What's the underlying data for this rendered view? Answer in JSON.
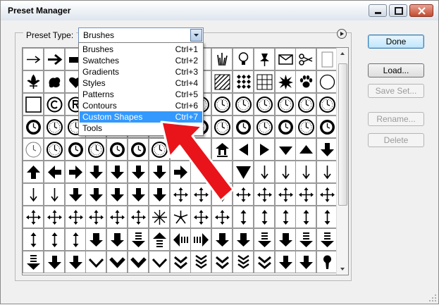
{
  "window": {
    "title": "Preset Manager",
    "controls": [
      "minimize-icon",
      "maximize-icon",
      "close-icon"
    ]
  },
  "preset_type": {
    "label": "Preset Type:",
    "selected": "Brushes",
    "options": [
      {
        "label": "Brushes",
        "shortcut": "Ctrl+1"
      },
      {
        "label": "Swatches",
        "shortcut": "Ctrl+2"
      },
      {
        "label": "Gradients",
        "shortcut": "Ctrl+3"
      },
      {
        "label": "Styles",
        "shortcut": "Ctrl+4"
      },
      {
        "label": "Patterns",
        "shortcut": "Ctrl+5"
      },
      {
        "label": "Contours",
        "shortcut": "Ctrl+6"
      },
      {
        "label": "Custom Shapes",
        "shortcut": "Ctrl+7"
      },
      {
        "label": "Tools",
        "shortcut": "Ctrl+8"
      }
    ],
    "highlighted": "Custom Shapes"
  },
  "buttons": {
    "done": "Done",
    "load": "Load...",
    "save_set": "Save Set...",
    "rename": "Rename...",
    "delete": "Delete"
  },
  "shapes_rows": [
    [
      "arrow-thin-right",
      "arrow-bold-right",
      "rect-bar",
      "",
      "",
      "",
      "",
      "",
      "",
      "grass",
      "lightbulb",
      "pushpin",
      "envelope",
      "scissors",
      "blank-frame"
    ],
    [
      "fleur-de-lis",
      "blob",
      "heart",
      "",
      "",
      "",
      "",
      "",
      "",
      "hatched-square",
      "diamond-grid",
      "grid-square",
      "burst",
      "paw-print",
      "circle-outline"
    ],
    [
      "square-outline",
      "copyright-circle",
      "registered-circle",
      "",
      "",
      "",
      "",
      "",
      "clock-face",
      "clock-face",
      "clock-face",
      "clock-face",
      "clock-face",
      "clock-face",
      "clock-face"
    ],
    [
      "clock-face-dark",
      "clock-face",
      "clock-face",
      "",
      "",
      "",
      "",
      "",
      "clock-face-dark",
      "clock-face",
      "clock-face-dark",
      "clock-face",
      "clock-face-dark",
      "clock-face",
      "clock-face-dark"
    ],
    [
      "clock-face-light",
      "clock-face",
      "clock-face-dark",
      "clock-face",
      "clock-face-dark",
      "clock-face-dark",
      "clock-face",
      "",
      "",
      "home-arrow",
      "triangle-left",
      "triangle-right",
      "triangle-down",
      "triangle-up",
      "arrow-down-bold"
    ],
    [
      "arrow-up-bold",
      "arrow-left-bold",
      "arrow-right-bold",
      "arrow-down-bold",
      "arrow-down-bold",
      "arrow-down-bold",
      "arrow-down-bold",
      "arrow-right-bold",
      "",
      "",
      "triangle-down-large",
      "arrow-down-thin",
      "arrow-down-thin",
      "arrow-down-thin",
      "arrow-down-thin"
    ],
    [
      "arrow-down-thin",
      "arrow-down-thin",
      "arrow-down-bold",
      "arrow-down-bold",
      "arrow-down-bold",
      "arrow-down-bold",
      "arrow-down-bold",
      "four-way-arrow",
      "four-way-arrow",
      "arrow-down-thin",
      "four-way-arrow",
      "four-way-arrow",
      "four-way-arrow",
      "four-way-arrow",
      "four-way-arrow"
    ],
    [
      "four-way-arrow",
      "four-way-arrow",
      "four-way-arrow",
      "four-way-arrow",
      "four-way-arrow",
      "four-way-arrow",
      "starburst-arrows",
      "radial-arrows",
      "four-way-arrow",
      "four-way-arrow",
      "double-arrow-vertical",
      "double-arrow-vertical",
      "double-arrow-vertical",
      "double-arrow-vertical",
      "double-arrow-vertical"
    ],
    [
      "double-arrow-vertical",
      "double-arrow-vertical",
      "double-arrow-vertical",
      "arrow-down-block",
      "arrow-down-block",
      "striped-arrow-down",
      "striped-arrow-up",
      "striped-arrow-left",
      "striped-arrow-right",
      "arrow-down-block",
      "arrow-down-block",
      "striped-arrow-down",
      "arrow-down-block",
      "striped-arrow-down",
      "striped-arrow-down"
    ],
    [
      "striped-arrow-down",
      "arrow-down-bold",
      "arrow-down-bold",
      "chevron-down",
      "chevron-down-bold",
      "chevron-down-bold",
      "chevron-down",
      "double-chevron-down",
      "triple-chevron-down",
      "double-chevron-down",
      "triple-chevron-down",
      "double-chevron-down",
      "arrow-down-bold",
      "arrow-down-bold",
      "keyhole"
    ]
  ],
  "colors": {
    "selection": "#3399ff",
    "accent_arrow": "#e8141a",
    "done_border": "#3c7fb1"
  }
}
